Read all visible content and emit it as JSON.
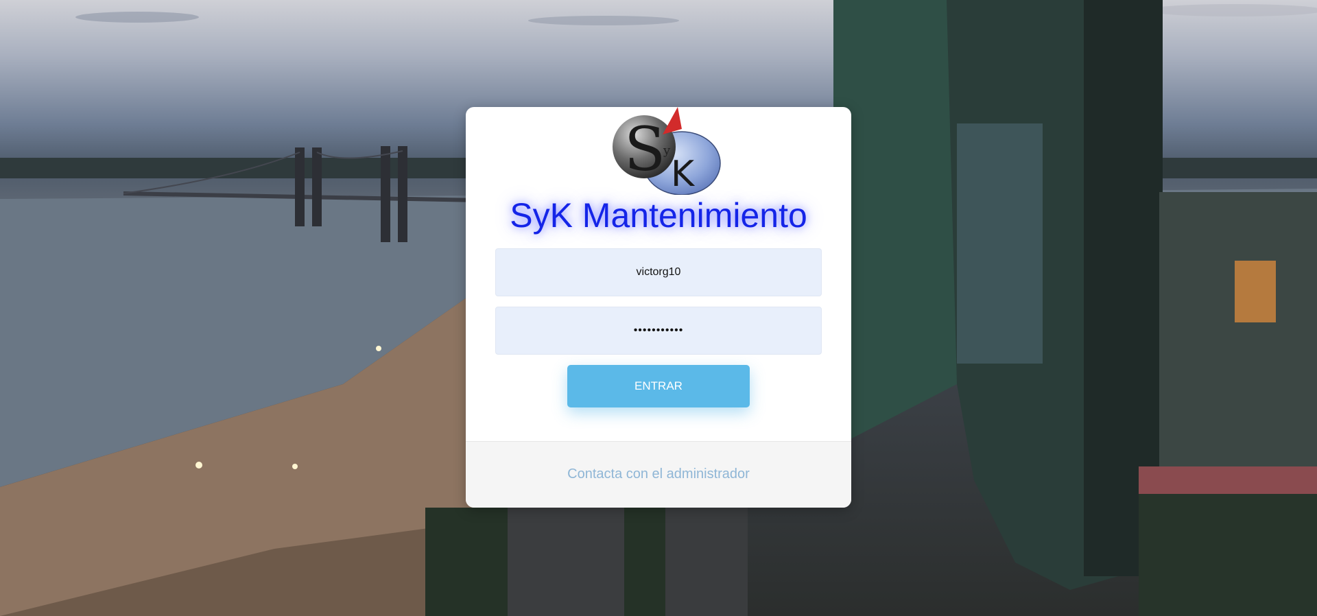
{
  "app": {
    "title": "SyK Mantenimiento"
  },
  "logo": {
    "letters": [
      "S",
      "y",
      "K"
    ]
  },
  "login": {
    "username_value": "victorg10",
    "password_value": "•••••••••••",
    "submit_label": "ENTRAR"
  },
  "footer": {
    "contact_label": "Contacta con el administrador"
  },
  "colors": {
    "title": "#1424e8",
    "button": "#5bb9e8",
    "input_bg": "#e8effb",
    "footer_link": "#8fb6d6"
  }
}
